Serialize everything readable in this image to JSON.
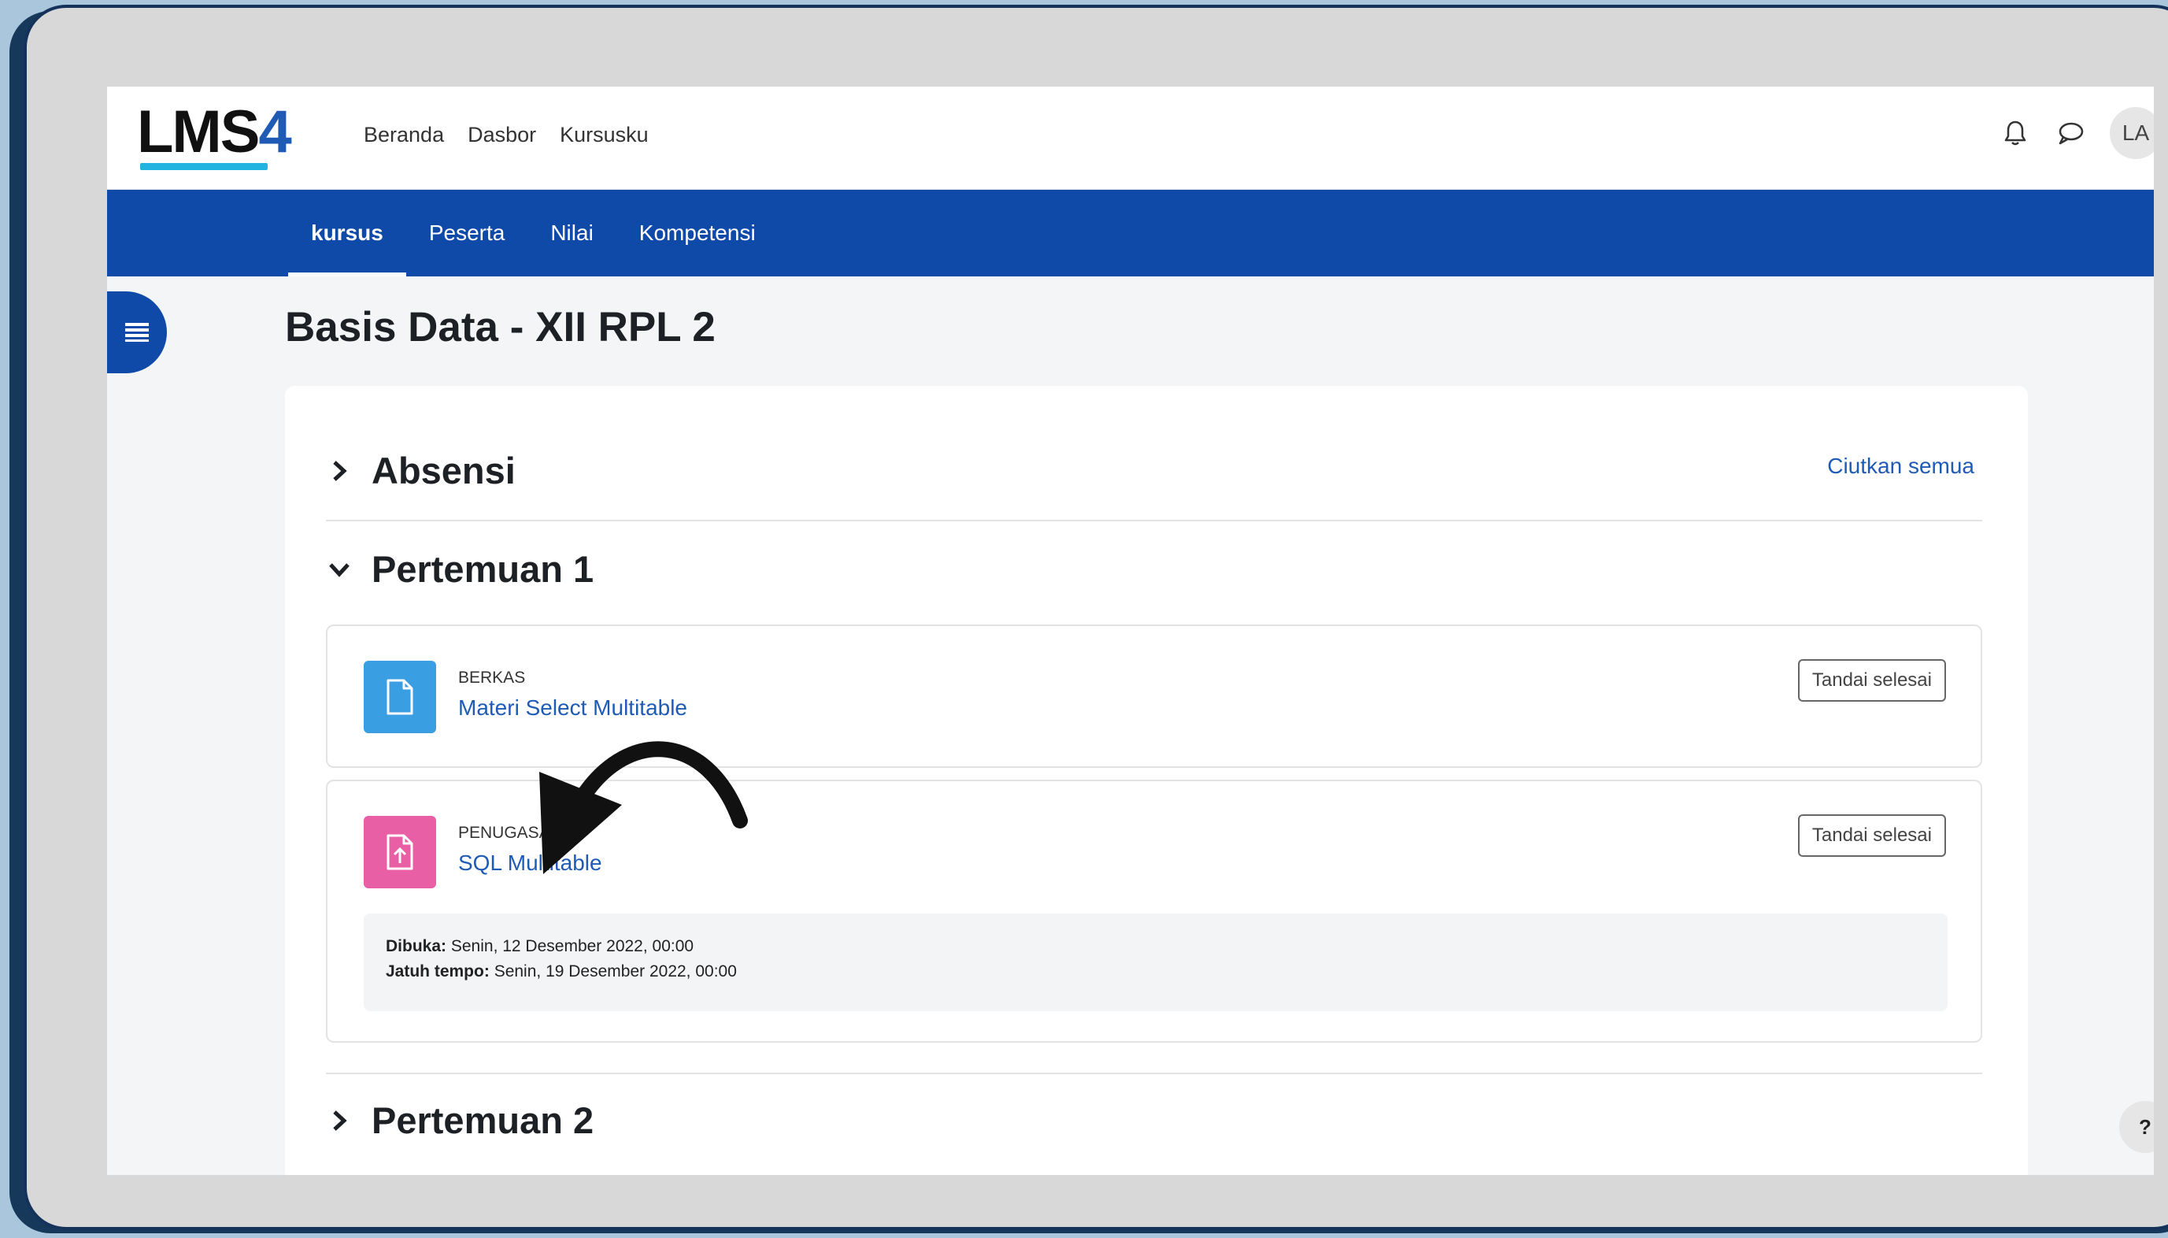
{
  "brand": {
    "logo_main": "LMS",
    "logo_accent": "4"
  },
  "top_nav": {
    "links": [
      "Beranda",
      "Dasbor",
      "Kursusku"
    ]
  },
  "user": {
    "initials": "LA"
  },
  "course_nav": {
    "tabs": [
      "kursus",
      "Peserta",
      "Nilai",
      "Kompetensi"
    ],
    "active_tab": "kursus"
  },
  "course": {
    "title": "Basis Data - XII RPL 2"
  },
  "collapse_all_label": "Ciutkan semua",
  "sections": {
    "absensi": {
      "title": "Absensi",
      "state": "collapsed"
    },
    "pertemuan1": {
      "title": "Pertemuan 1",
      "state": "expanded"
    },
    "pertemuan2": {
      "title": "Pertemuan 2",
      "state": "collapsed"
    }
  },
  "activities": [
    {
      "type": "BERKAS",
      "name": "Materi Select Multitable",
      "icon": "file-icon",
      "icon_color": "#3a9ee3",
      "button": "Tandai selesai"
    },
    {
      "type": "PENUGASAN",
      "name": "SQL Multitable",
      "icon": "assignment-upload-icon",
      "icon_color": "#e85fa6",
      "button": "Tandai selesai",
      "dates": {
        "opened_label": "Dibuka:",
        "opened_value": "Senin, 12 Desember 2022, 00:00",
        "due_label": "Jatuh tempo:",
        "due_value": "Senin, 19 Desember 2022, 00:00"
      }
    }
  ],
  "help": {
    "label": "?"
  },
  "colors": {
    "primary": "#0f4aa8",
    "link": "#1f5bb5",
    "frame": "#15335a",
    "background": "#a9c6dc"
  }
}
